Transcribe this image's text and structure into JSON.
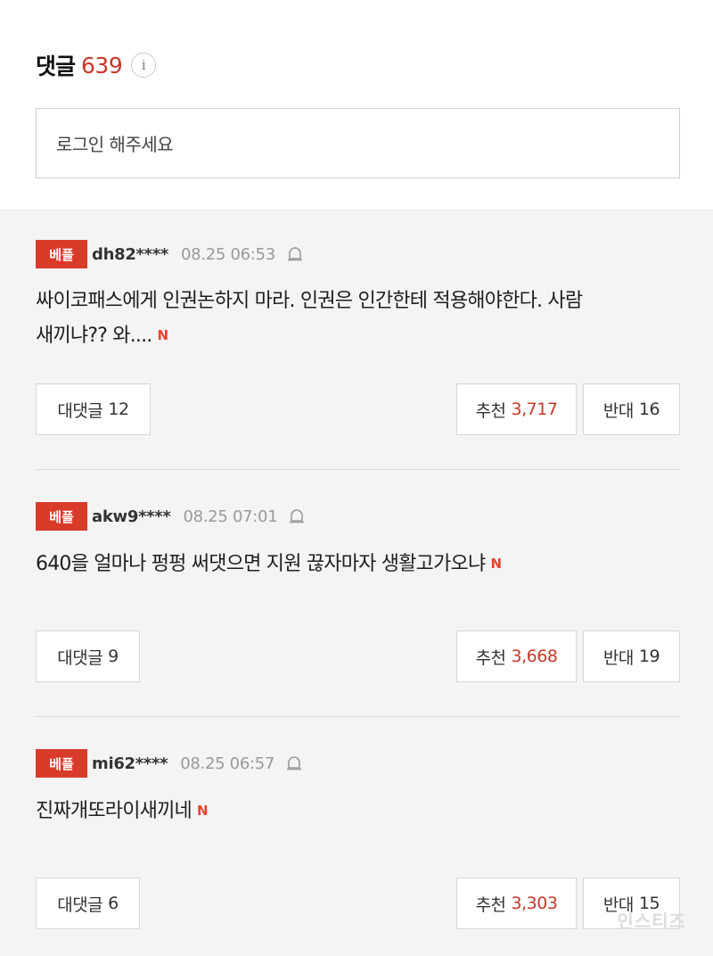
{
  "header": {
    "title": "댓글",
    "count": "639",
    "info_glyph": "i"
  },
  "login": {
    "placeholder": "로그인 해주세요"
  },
  "comments": [
    {
      "badge": "베플",
      "user": "dh82****",
      "date": "08.25 06:53",
      "text_line1": "싸이코패스에게 인권논하지 마라. 인권은 인간한테 적용해야한다. 사람",
      "text_line2": "새끼냐?? 와....",
      "new_mark": "N",
      "replies_label": "대댓글",
      "replies_count": "12",
      "like_label": "추천",
      "like_count": "3,717",
      "dislike_label": "반대",
      "dislike_count": "16"
    },
    {
      "badge": "베플",
      "user": "akw9****",
      "date": "08.25 07:01",
      "text_line1": "640을 얼마나 펑펑 써댓으면 지원 끊자마자 생활고가오냐",
      "text_line2": "",
      "new_mark": "N",
      "replies_label": "대댓글",
      "replies_count": "9",
      "like_label": "추천",
      "like_count": "3,668",
      "dislike_label": "반대",
      "dislike_count": "19"
    },
    {
      "badge": "베플",
      "user": "mi62****",
      "date": "08.25 06:57",
      "text_line1": "진짜개또라이새끼네",
      "text_line2": "",
      "new_mark": "N",
      "replies_label": "대댓글",
      "replies_count": "6",
      "like_label": "추천",
      "like_count": "3,303",
      "dislike_label": "반대",
      "dislike_count": "15"
    }
  ],
  "watermark": "인스티즈",
  "colors": {
    "accent_red": "#c7392a",
    "badge_red": "#d83b2a",
    "background": "#f4f4f4"
  },
  "icons": [
    "info-icon",
    "alert-bell-icon",
    "new-mark-icon"
  ]
}
